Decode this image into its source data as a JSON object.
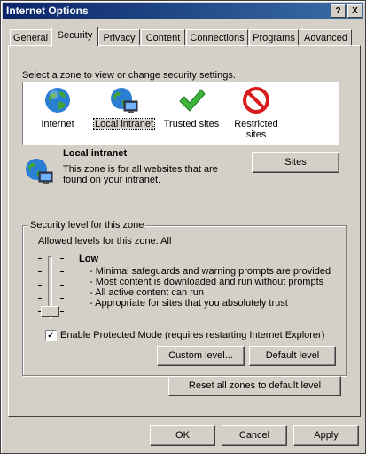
{
  "window": {
    "title": "Internet Options",
    "help_btn": "?",
    "close_btn": "X"
  },
  "tabs": [
    {
      "label": "General"
    },
    {
      "label": "Security"
    },
    {
      "label": "Privacy"
    },
    {
      "label": "Content"
    },
    {
      "label": "Connections"
    },
    {
      "label": "Programs"
    },
    {
      "label": "Advanced"
    }
  ],
  "zones": {
    "prompt": "Select a zone to view or change security settings.",
    "items": [
      {
        "label": "Internet",
        "icon": "globe-icon"
      },
      {
        "label": "Local intranet",
        "icon": "local-intranet-icon",
        "selected": true
      },
      {
        "label": "Trusted sites",
        "icon": "checkmark-icon"
      },
      {
        "label": "Restricted sites",
        "label_line1": "Restricted",
        "label_line2": "sites",
        "icon": "prohibited-icon"
      }
    ]
  },
  "zone_info": {
    "title": "Local intranet",
    "desc_line1": "This zone is for all websites that are",
    "desc_line2": "found on your intranet.",
    "sites_btn": "Sites"
  },
  "security": {
    "group_label": "Security level for this zone",
    "allowed": "Allowed levels for this zone: All",
    "level": "Low",
    "bullets": [
      "- Minimal safeguards and warning prompts are provided",
      "- Most content is downloaded and run without prompts",
      "- All active content can run",
      "- Appropriate for sites that you absolutely trust"
    ],
    "slider_marks": "-",
    "protected_mode": "Enable Protected Mode (requires restarting Internet Explorer)",
    "protected_checked": true,
    "protected_check_glyph": "✓",
    "custom_btn": "Custom level...",
    "default_btn": "Default level"
  },
  "reset_btn": "Reset all zones to default level",
  "footer": {
    "ok": "OK",
    "cancel": "Cancel",
    "apply": "Apply"
  }
}
